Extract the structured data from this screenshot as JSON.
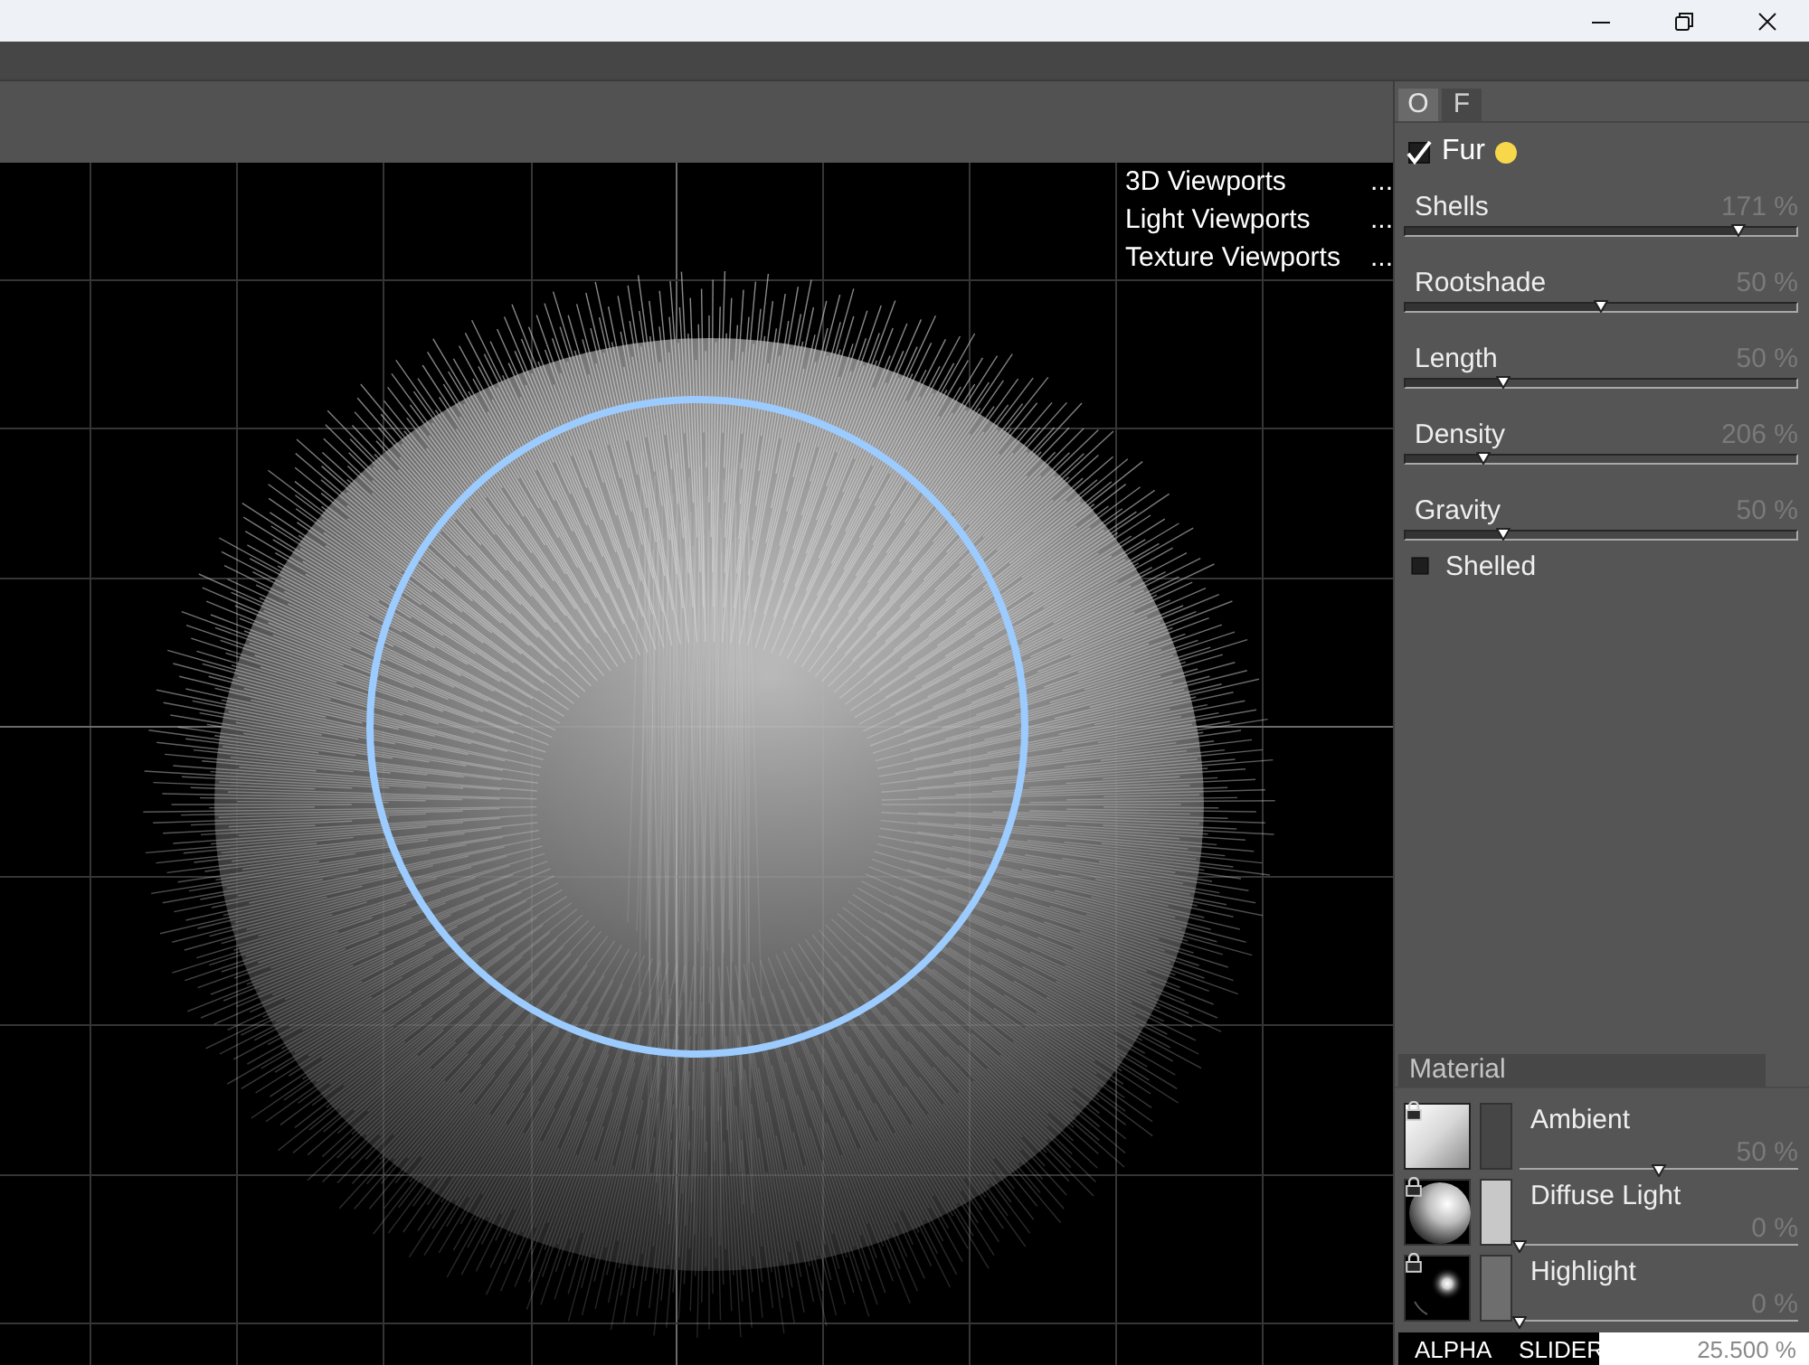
{
  "viewport": {
    "menu": [
      {
        "label": "3D Viewports",
        "more": "..."
      },
      {
        "label": "Light Viewports",
        "more": "..."
      },
      {
        "label": "Texture Viewports",
        "more": "..."
      }
    ]
  },
  "panel": {
    "tabs": [
      {
        "label": "O",
        "selected": true
      },
      {
        "label": "F",
        "selected": false
      }
    ],
    "fur": {
      "label": "Fur",
      "checked": true
    },
    "sliders": [
      {
        "label": "Shells",
        "reading": "171 %",
        "level": 0.85
      },
      {
        "label": "Rootshade",
        "reading": "50 %",
        "level": 0.5
      },
      {
        "label": "Length",
        "reading": "50 %",
        "level": 0.25
      },
      {
        "label": "Density",
        "reading": "206 %",
        "level": 0.2
      },
      {
        "label": "Gravity",
        "reading": "50 %",
        "level": 0.25
      }
    ],
    "shelled": {
      "label": "Shelled",
      "checked": false
    }
  },
  "material": {
    "title": "Material",
    "channels": [
      {
        "kind": "ambient",
        "label": "Ambient",
        "reading": "50 %",
        "level": 0.5,
        "color": "#464646"
      },
      {
        "kind": "diffuse",
        "label": "Diffuse Light",
        "reading": "0 %",
        "level": 0,
        "color": "#c8c8c8"
      },
      {
        "kind": "highlight",
        "label": "Highlight",
        "reading": "0 %",
        "level": 0,
        "color": "#6e6e6e"
      }
    ]
  },
  "alpha_slider": {
    "label": "ALPHA SLIDER",
    "reading": "25.500 %",
    "level": 0.49
  }
}
